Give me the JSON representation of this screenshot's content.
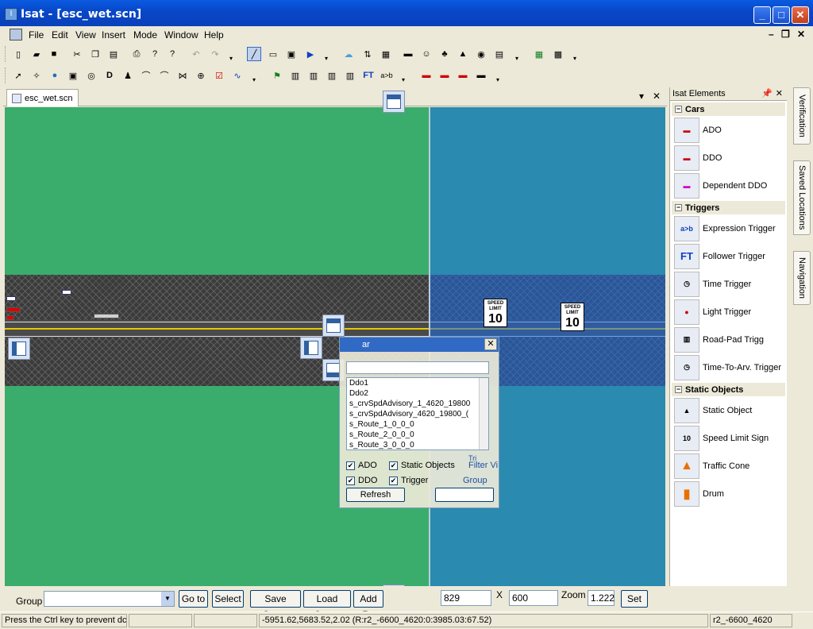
{
  "window": {
    "title": "Isat - [esc_wet.scn]",
    "min": "_",
    "max": "□",
    "close": "✕"
  },
  "menu": {
    "items": [
      "File",
      "Edit",
      "View",
      "Insert",
      "Mode",
      "Window",
      "Help"
    ],
    "mdi_min": "–",
    "mdi_restore": "❐",
    "mdi_close": "✕"
  },
  "document": {
    "tab": "esc_wet.scn",
    "pin": "▾",
    "close": "✕"
  },
  "canvas": {
    "signs": [
      {
        "line1": "SPEED",
        "line2": "LIMIT",
        "value": "10"
      },
      {
        "line1": "SPEED",
        "line2": "LIMIT",
        "value": "10"
      }
    ]
  },
  "finder": {
    "title": "ar",
    "close": "✕",
    "list": [
      "Ddo1",
      "Ddo2",
      "s_crvSpdAdvisory_1_4620_19800",
      "s_crvSpdAdvisory_4620_19800_(",
      "s_Route_1_0_0_0",
      "s_Route_2_0_0_0",
      "s_Route_3_0_0_0"
    ],
    "checks": [
      {
        "label": "ADO",
        "checked": "✔"
      },
      {
        "label": "Static Objects",
        "checked": "✔"
      },
      {
        "label": "DDO",
        "checked": "✔"
      },
      {
        "label": "Trigger",
        "checked": "✔"
      }
    ],
    "filter_label": "Filter Vi",
    "group_label": "Group",
    "refresh": "Refresh",
    "tri_label": "Tri"
  },
  "elements_panel": {
    "title": "Isat Elements",
    "pin": "📌",
    "close": "✕",
    "categories": [
      {
        "name": "Cars",
        "items": [
          {
            "label": "ADO",
            "icon": "ado-icon"
          },
          {
            "label": "DDO",
            "icon": "ddo-icon"
          },
          {
            "label": "Dependent DDO",
            "icon": "dependent-ddo-icon"
          }
        ]
      },
      {
        "name": "Triggers",
        "items": [
          {
            "label": "Expression Trigger",
            "icon": "expression-trigger-icon"
          },
          {
            "label": "Follower Trigger",
            "icon": "follower-trigger-icon"
          },
          {
            "label": "Time Trigger",
            "icon": "time-trigger-icon"
          },
          {
            "label": "Light Trigger",
            "icon": "light-trigger-icon"
          },
          {
            "label": "Road-Pad Trigg",
            "icon": "road-pad-trigger-icon"
          },
          {
            "label": "Time-To-Arv. Trigger",
            "icon": "time-to-arrival-trigger-icon"
          }
        ]
      },
      {
        "name": "Static Objects",
        "items": [
          {
            "label": "Static Object",
            "icon": "static-object-icon"
          },
          {
            "label": "Speed Limit Sign",
            "icon": "speed-limit-sign-icon"
          },
          {
            "label": "Traffic Cone",
            "icon": "traffic-cone-icon"
          },
          {
            "label": "Drum",
            "icon": "drum-icon"
          }
        ]
      }
    ]
  },
  "side_tabs": [
    "Verification",
    "Saved Locations",
    "Navigation"
  ],
  "bottom": {
    "group_label": "Group",
    "group_value": "",
    "goto": "Go to",
    "select": "Select",
    "save_group": "Save Group",
    "load_group": "Load Group",
    "add_re": "Add Re",
    "x_value": "829",
    "times": "X",
    "y_value": "600",
    "zoom_label": "Zoom",
    "zoom_value": "1.222",
    "set": "Set"
  },
  "status": {
    "hint": "Press the Ctrl key to prevent dc",
    "coords": "-5951.62,5683.52,2.02 (R:r2_-6600_4620:0:3985.03:67.52)",
    "road": "r2_-6600_4620"
  },
  "colors": {
    "terrain": "#3aad6d",
    "overlay": "#1e6ee6",
    "titlebar": "#0a5be0"
  }
}
